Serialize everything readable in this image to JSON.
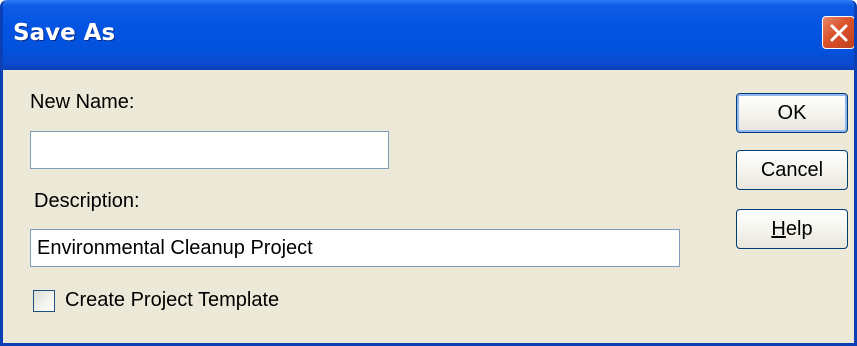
{
  "window": {
    "title": "Save As"
  },
  "form": {
    "new_name_label": "New Name:",
    "new_name_value": "",
    "description_label": "Description:",
    "description_value": "Environmental Cleanup Project",
    "template_checkbox_label": "Create Project Template",
    "template_checked": false
  },
  "buttons": {
    "ok_label": "OK",
    "cancel_label": "Cancel",
    "help_mnemonic": "H",
    "help_rest": "elp"
  },
  "colors": {
    "titlebar": "#0354e2",
    "dialog_bg": "#ece9d8",
    "close_button": "#d9532c"
  },
  "icons": {
    "close": "close-icon"
  }
}
